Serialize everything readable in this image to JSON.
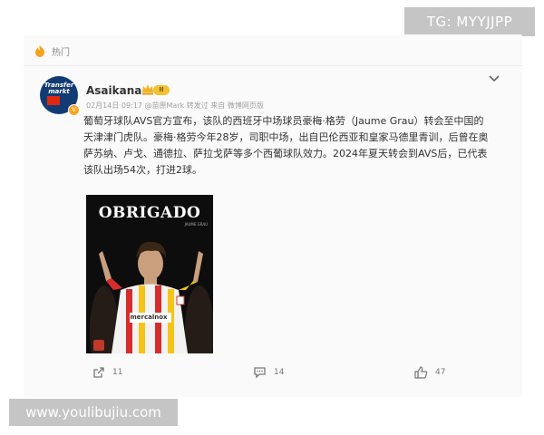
{
  "watermarks": {
    "top_right": "TG: MYYJJPP",
    "bottom_left": "www.youlibujiu.com"
  },
  "section": {
    "label": "热门",
    "icon": "hot-flame-icon"
  },
  "post": {
    "author": "Asaikana",
    "avatar_text": "Transfer markt",
    "level_badge": "II",
    "verified_icon": "verified-v-icon",
    "meta": "02月14日 09:17 @苗原Mark 转发过 来自 微博网页版",
    "text": "葡萄牙球队AVS官方宣布，该队的西班牙中场球员豪梅·格劳（Jaume Grau）转会至中国的天津津门虎队。豪梅·格劳今年28岁，司职中场，出自巴伦西亚和皇家马德里青训，后曾在奥萨苏纳、卢戈、通德拉、萨拉戈萨等多个西葡球队效力。2024年夏天转会到AVS后，已代表该队出场54次，打进2球。",
    "image": {
      "headline": "OBRIGADO",
      "caption": "JAUME GRAU",
      "shirt_sponsor": "mercalnox"
    }
  },
  "actions": {
    "repost_count": "11",
    "comment_count": "14",
    "like_count": "47"
  },
  "colors": {
    "card_bg": "#fafafa",
    "watermark_bg": "#c5c5c5",
    "avatar_bg": "#133b73",
    "badge_gold": "#f1c232"
  }
}
